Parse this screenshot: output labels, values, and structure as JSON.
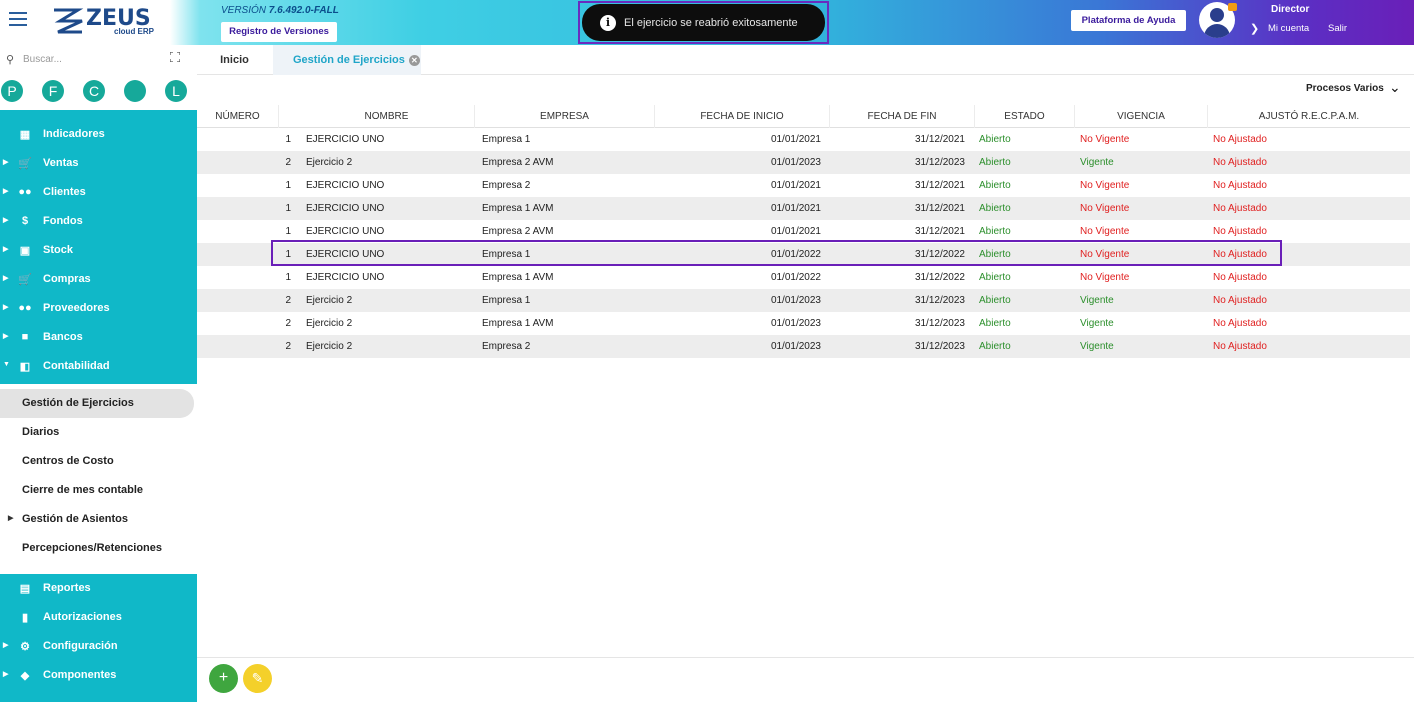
{
  "header": {
    "logo_text": "ZEUS",
    "logo_sub": "cloud ERP",
    "version_prefix": "VERSIÓN",
    "version_number": "7.6.492.0-FALL",
    "registro_label": "Registro de Versiones",
    "toast_message": "El ejercicio se reabrió exitosamente",
    "help_label": "Plataforma de Ayuda",
    "user_name": "Director",
    "mi_cuenta": "Mi cuenta",
    "salir": "Salir"
  },
  "sidebar": {
    "search_placeholder": "Buscar...",
    "shortcuts": [
      "P",
      "F",
      "C",
      "",
      "L"
    ],
    "modules_top": [
      {
        "label": "Indicadores",
        "icon": "dashboard-icon",
        "arrow": false
      },
      {
        "label": "Ventas",
        "icon": "cart-icon",
        "arrow": true
      },
      {
        "label": "Clientes",
        "icon": "users-icon",
        "arrow": true
      },
      {
        "label": "Fondos",
        "icon": "dollar-icon",
        "arrow": true
      },
      {
        "label": "Stock",
        "icon": "box-icon",
        "arrow": true
      },
      {
        "label": "Compras",
        "icon": "cart-plus-icon",
        "arrow": true
      },
      {
        "label": "Proveedores",
        "icon": "users-icon",
        "arrow": true
      },
      {
        "label": "Bancos",
        "icon": "bank-icon",
        "arrow": true
      },
      {
        "label": "Contabilidad",
        "icon": "book-icon",
        "arrow": true
      }
    ],
    "contabilidad_items": [
      {
        "label": "Gestión de Ejercicios",
        "active": true,
        "arrow": false
      },
      {
        "label": "Diarios",
        "active": false,
        "arrow": false
      },
      {
        "label": "Centros de Costo",
        "active": false,
        "arrow": false
      },
      {
        "label": "Cierre de mes contable",
        "active": false,
        "arrow": false
      },
      {
        "label": "Gestión de Asientos",
        "active": false,
        "arrow": true
      },
      {
        "label": "Percepciones/Retenciones",
        "active": false,
        "arrow": false
      }
    ],
    "modules_bottom": [
      {
        "label": "Reportes",
        "icon": "report-icon",
        "arrow": false
      },
      {
        "label": "Autorizaciones",
        "icon": "lock-icon",
        "arrow": false
      },
      {
        "label": "Configuración",
        "icon": "gear-icon",
        "arrow": true
      },
      {
        "label": "Componentes",
        "icon": "tag-icon",
        "arrow": true
      }
    ]
  },
  "tabs": {
    "inicio": "Inicio",
    "active": "Gestión de Ejercicios"
  },
  "toolbar": {
    "procesos_label": "Procesos Varios"
  },
  "table": {
    "columns": [
      "NÚMERO",
      "NOMBRE",
      "EMPRESA",
      "FECHA DE INICIO",
      "FECHA DE FIN",
      "ESTADO",
      "VIGENCIA",
      "AJUSTÓ R.E.C.P.A.M."
    ],
    "rows": [
      [
        "1",
        "EJERCICIO UNO",
        "Empresa 1",
        "01/01/2021",
        "31/12/2021",
        "Abierto",
        "No Vigente",
        "No Ajustado"
      ],
      [
        "2",
        "Ejercicio 2",
        "Empresa 2 AVM",
        "01/01/2023",
        "31/12/2023",
        "Abierto",
        "Vigente",
        "No Ajustado"
      ],
      [
        "1",
        "EJERCICIO UNO",
        "Empresa 2",
        "01/01/2021",
        "31/12/2021",
        "Abierto",
        "No Vigente",
        "No Ajustado"
      ],
      [
        "1",
        "EJERCICIO UNO",
        "Empresa 1 AVM",
        "01/01/2021",
        "31/12/2021",
        "Abierto",
        "No Vigente",
        "No Ajustado"
      ],
      [
        "1",
        "EJERCICIO UNO",
        "Empresa 2 AVM",
        "01/01/2021",
        "31/12/2021",
        "Abierto",
        "No Vigente",
        "No Ajustado"
      ],
      [
        "1",
        "EJERCICIO UNO",
        "Empresa 1",
        "01/01/2022",
        "31/12/2022",
        "Abierto",
        "No Vigente",
        "No Ajustado"
      ],
      [
        "1",
        "EJERCICIO UNO",
        "Empresa 1 AVM",
        "01/01/2022",
        "31/12/2022",
        "Abierto",
        "No Vigente",
        "No Ajustado"
      ],
      [
        "2",
        "Ejercicio 2",
        "Empresa 1",
        "01/01/2023",
        "31/12/2023",
        "Abierto",
        "Vigente",
        "No Ajustado"
      ],
      [
        "2",
        "Ejercicio 2",
        "Empresa 1 AVM",
        "01/01/2023",
        "31/12/2023",
        "Abierto",
        "Vigente",
        "No Ajustado"
      ],
      [
        "2",
        "Ejercicio 2",
        "Empresa 2",
        "01/01/2023",
        "31/12/2023",
        "Abierto",
        "Vigente",
        "No Ajustado"
      ]
    ],
    "selected_row": 5
  },
  "colors": {
    "teal": "#10b8c8",
    "green": "#2c8f2c",
    "red": "#e02020",
    "purple": "#6a1fb8"
  }
}
